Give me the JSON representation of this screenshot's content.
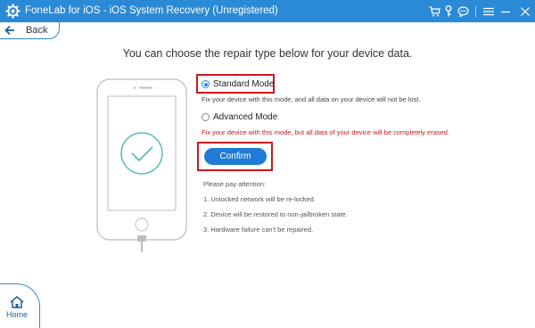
{
  "window": {
    "title": "FoneLab for iOS - iOS System Recovery (Unregistered)",
    "toolbar_icons": [
      "cart-icon",
      "key-icon",
      "chat-icon",
      "menu-icon"
    ],
    "controls": [
      "minimize-icon",
      "close-icon"
    ]
  },
  "nav": {
    "back_label": "Back",
    "home_label": "Home"
  },
  "main": {
    "heading": "You can choose the repair type below for your device data.",
    "standard": {
      "label": "Standard Mode",
      "selected": true,
      "description": "Fix your device with this mode, and all data on your device will not be lost."
    },
    "advanced": {
      "label": "Advanced Mode",
      "selected": false,
      "description": "Fix your device with this mode, but all data of your device will be completely erased."
    },
    "confirm_label": "Confirm",
    "attention": {
      "title": "Please pay attention:",
      "items": [
        "1. Unlocked network will be re-locked.",
        "2. Device will be restored to non-jailbroken state.",
        "3. Hardware failure can't be repaired."
      ]
    }
  },
  "colors": {
    "titlebar": "#2b8ad6",
    "accent": "#1f7bd6",
    "highlight": "#d0141e",
    "warning_text": "#d0141e",
    "check": "#5cbcb7"
  }
}
